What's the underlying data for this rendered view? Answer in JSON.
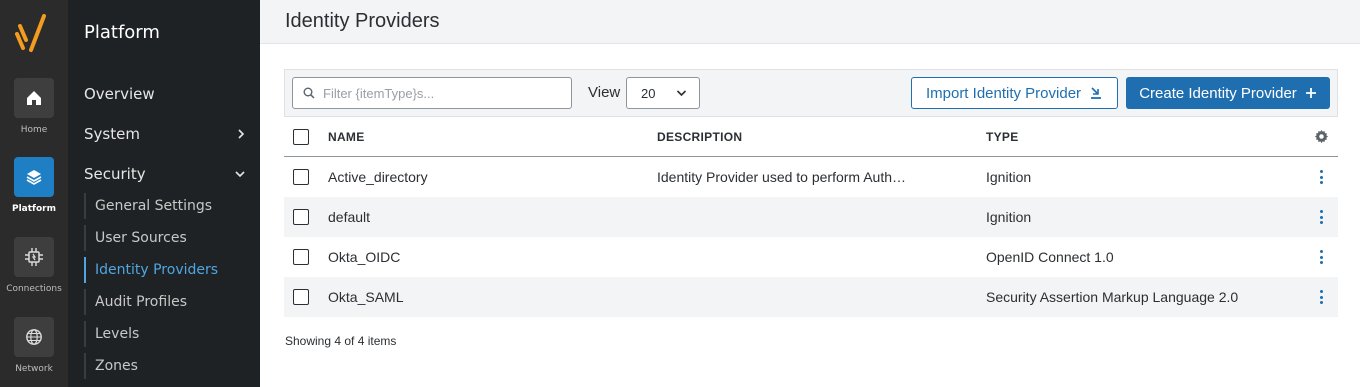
{
  "rail": {
    "items": [
      {
        "label": "Home",
        "icon": "home-icon"
      },
      {
        "label": "Platform",
        "icon": "layers-icon",
        "active": true
      },
      {
        "label": "Connections",
        "icon": "connections-icon"
      },
      {
        "label": "Network",
        "icon": "globe-icon"
      }
    ]
  },
  "nav": {
    "title": "Platform",
    "items": [
      {
        "label": "Overview"
      },
      {
        "label": "System"
      },
      {
        "label": "Security"
      }
    ],
    "security_sub": [
      {
        "label": "General Settings"
      },
      {
        "label": "User Sources"
      },
      {
        "label": "Identity Providers",
        "active": true
      },
      {
        "label": "Audit Profiles"
      },
      {
        "label": "Levels"
      },
      {
        "label": "Zones"
      }
    ]
  },
  "page": {
    "title": "Identity Providers"
  },
  "toolbar": {
    "filter_placeholder": "Filter {itemType}s...",
    "view_label": "View",
    "view_value": "20",
    "import_label": "Import Identity Provider",
    "create_label": "Create Identity Provider"
  },
  "table": {
    "columns": [
      "NAME",
      "DESCRIPTION",
      "TYPE"
    ],
    "rows": [
      {
        "name": "Active_directory",
        "description": "Identity Provider used to perform Auth…",
        "type": "Ignition"
      },
      {
        "name": "default",
        "description": "",
        "type": "Ignition"
      },
      {
        "name": "Okta_OIDC",
        "description": "",
        "type": "OpenID Connect 1.0"
      },
      {
        "name": "Okta_SAML",
        "description": "",
        "type": "Security Assertion Markup Language 2.0"
      }
    ]
  },
  "footer": {
    "count_text": "Showing 4 of 4 items"
  },
  "colors": {
    "accent": "#1f6fb0",
    "rail_bg": "#2b2b2b",
    "nav_bg": "#1f2225",
    "active_nav": "#4fa6e0",
    "logo": "#f39c1f"
  }
}
